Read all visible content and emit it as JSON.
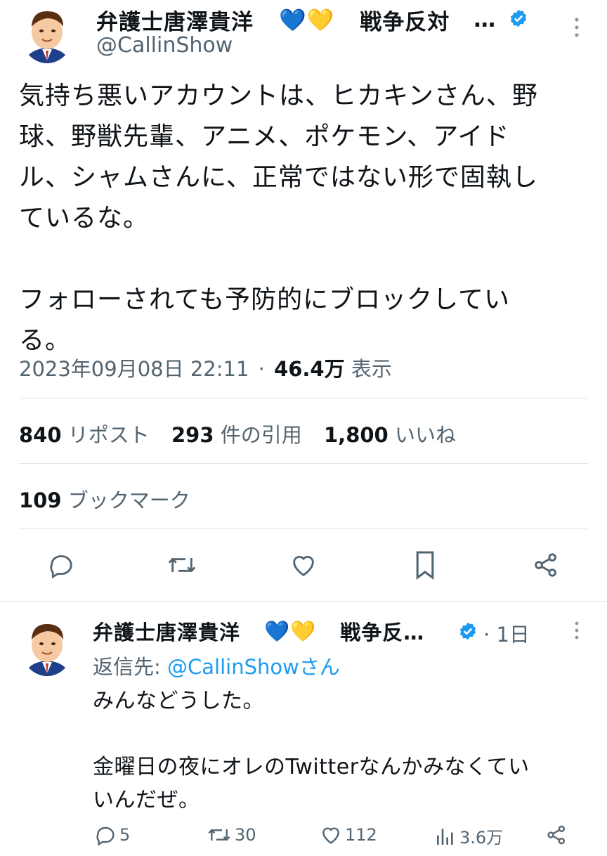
{
  "main_tweet": {
    "author_name": "弁護士唐澤貴洋",
    "emoji_blue": "💙",
    "emoji_yellow": "💛",
    "tagline": "戦争反対",
    "ellipsis": "…",
    "handle": "@CallinShow",
    "text_lines": [
      "気持ち悪いアカウントは、ヒカキンさん、野",
      "球、野獣先輩、アニメ、ポケモン、アイド",
      "ル、シャムさんに、正常ではない形で固執し",
      "ているな。",
      "",
      "フォローされても予防的にブロックしてい",
      "る。"
    ],
    "timestamp": "2023年09月08日 22:11",
    "dot": "·",
    "views_count": "46.4万",
    "views_label": "表示",
    "reposts_count": "840",
    "reposts_label": "リポスト",
    "quotes_count": "293",
    "quotes_label": "件の引用",
    "likes_count": "1,800",
    "likes_label": "いいね",
    "bookmarks_count": "109",
    "bookmarks_label": "ブックマーク"
  },
  "reply_tweet": {
    "author_name": "弁護士唐澤貴洋",
    "emoji_blue": "💙",
    "emoji_yellow": "💛",
    "tagline": "戦争反…",
    "dot": "·",
    "time": "1日",
    "reply_to_prefix": "返信先: ",
    "reply_to_handle": "@CallinShowさん",
    "text_lines": [
      "みんなどうした。",
      "",
      "金曜日の夜にオレのTwitterなんかみなくてい",
      "いんだぜ。"
    ],
    "replies": "5",
    "reposts": "30",
    "likes": "112",
    "views": "3.6万"
  },
  "colors": {
    "verified": "#1d9bf0",
    "link": "#1d9bf0",
    "muted": "#536471"
  }
}
